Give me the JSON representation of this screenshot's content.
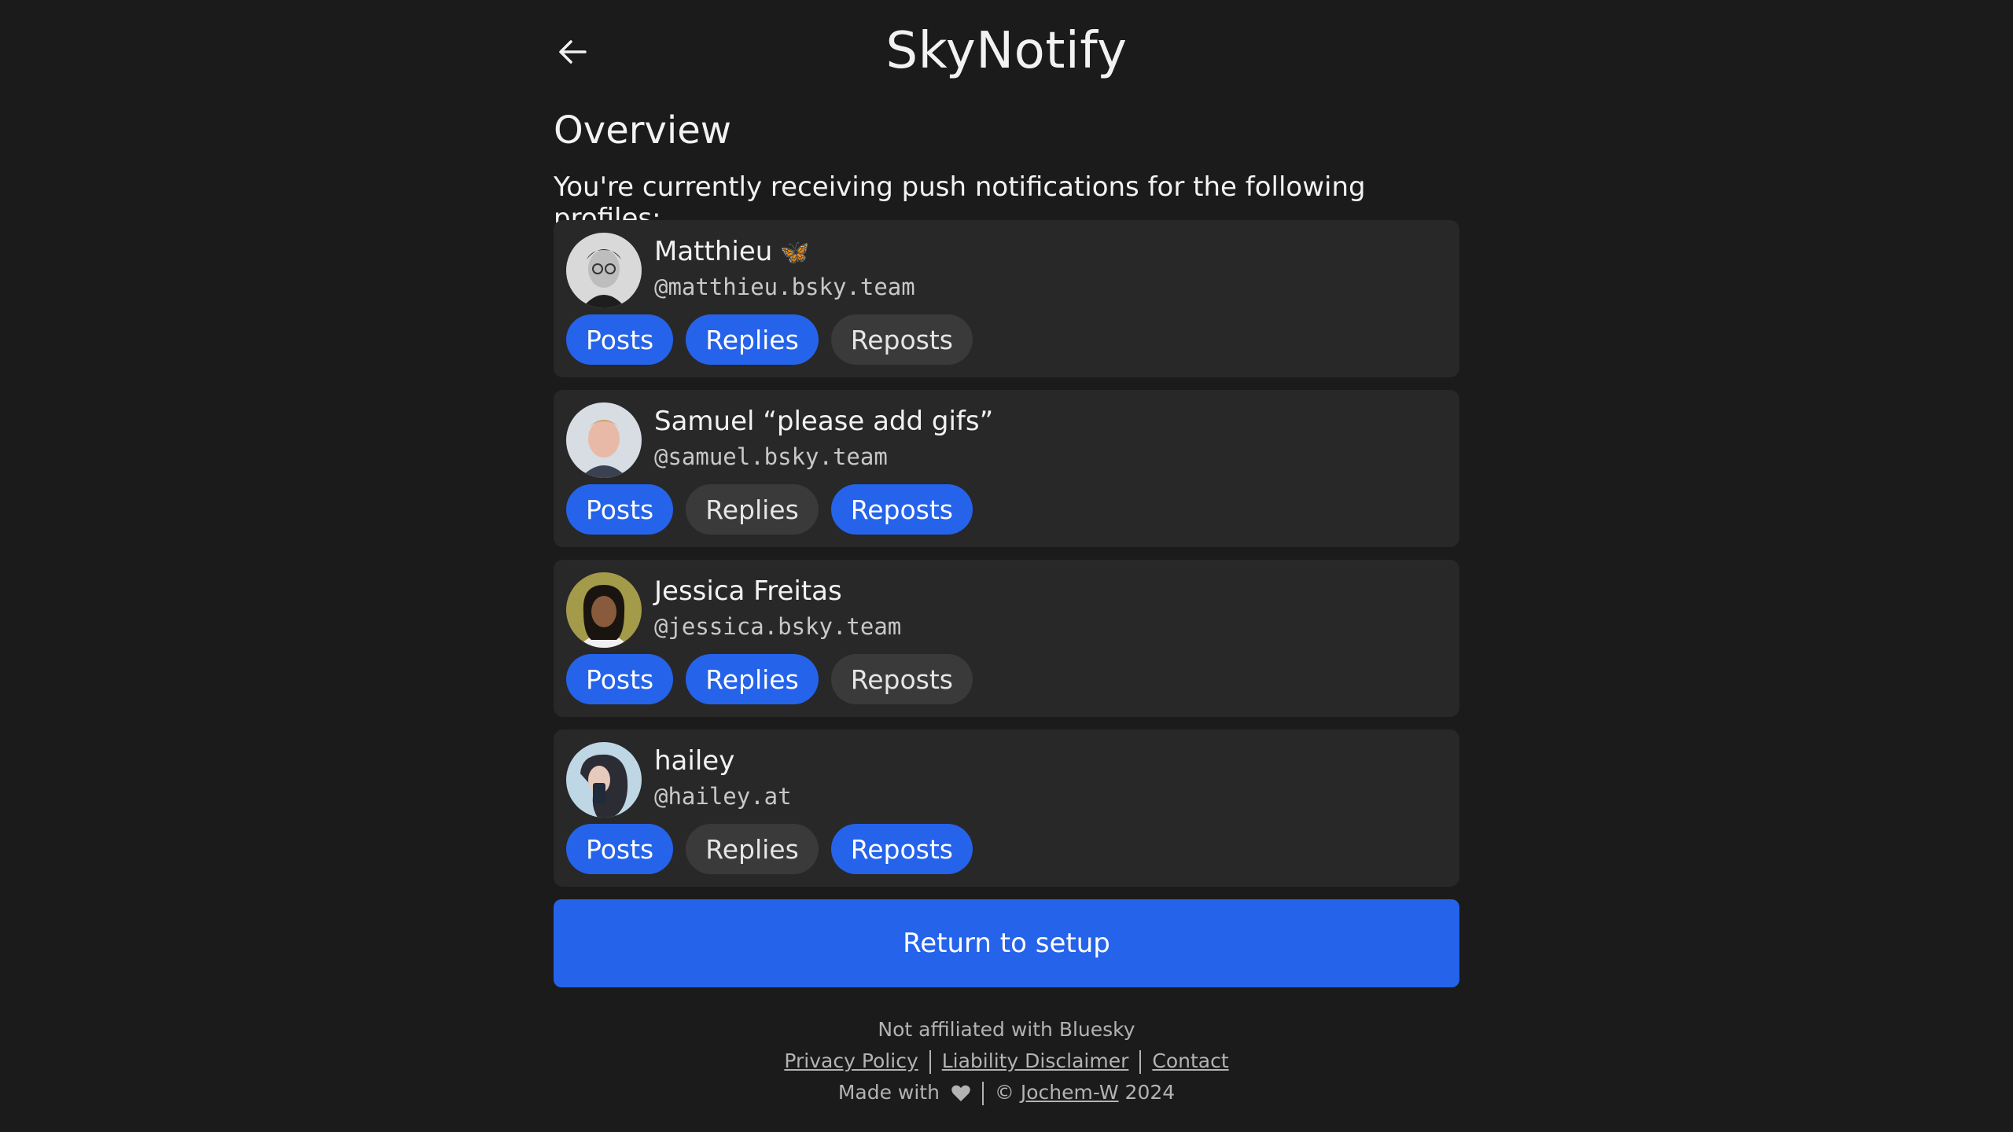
{
  "app": {
    "title": "SkyNotify"
  },
  "overview": {
    "heading": "Overview",
    "description": "You're currently receiving push notifications for the following profiles:"
  },
  "profiles": [
    {
      "name": "Matthieu",
      "name_emoji": "🦋",
      "handle": "@matthieu.bsky.team",
      "toggles": [
        {
          "label": "Posts",
          "on": true
        },
        {
          "label": "Replies",
          "on": true
        },
        {
          "label": "Reposts",
          "on": false
        }
      ]
    },
    {
      "name": "Samuel “please add gifs”",
      "handle": "@samuel.bsky.team",
      "toggles": [
        {
          "label": "Posts",
          "on": true
        },
        {
          "label": "Replies",
          "on": false
        },
        {
          "label": "Reposts",
          "on": true
        }
      ]
    },
    {
      "name": "Jessica Freitas",
      "handle": "@jessica.bsky.team",
      "toggles": [
        {
          "label": "Posts",
          "on": true
        },
        {
          "label": "Replies",
          "on": true
        },
        {
          "label": "Reposts",
          "on": false
        }
      ]
    },
    {
      "name": "hailey",
      "handle": "@hailey.at",
      "toggles": [
        {
          "label": "Posts",
          "on": true
        },
        {
          "label": "Replies",
          "on": false
        },
        {
          "label": "Reposts",
          "on": true
        }
      ]
    }
  ],
  "actions": {
    "return_label": "Return to setup"
  },
  "footer": {
    "disclaimer": "Not affiliated with Bluesky",
    "privacy": "Privacy Policy",
    "liability": "Liability Disclaimer",
    "contact": "Contact",
    "made_with": "Made with",
    "copyright_symbol": "©",
    "author": "Jochem-W",
    "year": "2024"
  },
  "colors": {
    "accent": "#2563eb",
    "background": "#1b1b1b",
    "card": "#282828",
    "toggle_off": "#3a3a3a"
  }
}
